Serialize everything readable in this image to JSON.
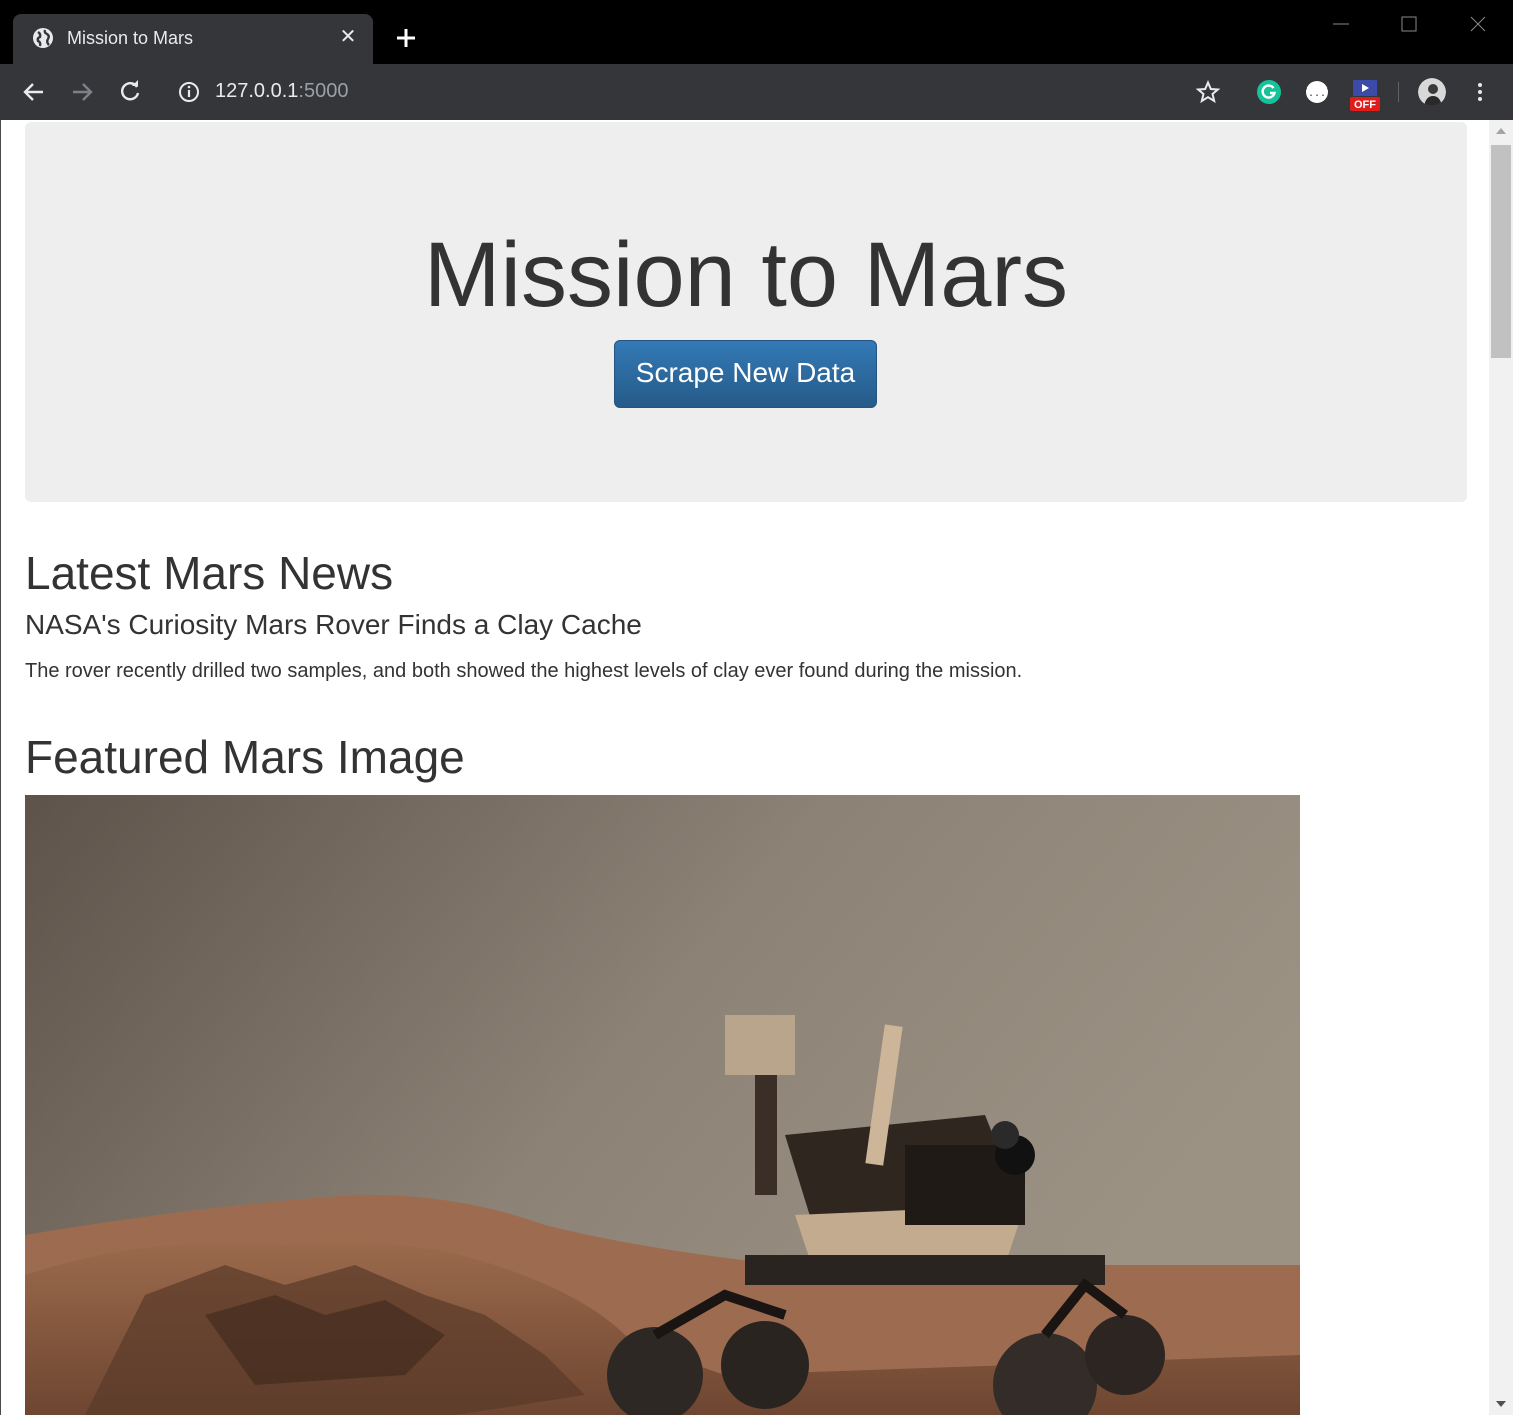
{
  "browser": {
    "tab_title": "Mission to Mars",
    "url_host": "127.0.0.1",
    "url_port": ":5000",
    "extension_badge": "OFF"
  },
  "page": {
    "jumbotron_title": "Mission to Mars",
    "scrape_button": "Scrape New Data",
    "news_heading": "Latest Mars News",
    "news_title": "NASA's Curiosity Mars Rover Finds a Clay Cache",
    "news_paragraph": "The rover recently drilled two samples, and both showed the highest levels of clay ever found during the mission.",
    "image_heading": "Featured Mars Image"
  },
  "colors": {
    "chrome_dark": "#35363a",
    "jumbotron_bg": "#eeeeee",
    "button_blue": "#337ab7",
    "grammarly_green": "#15c39a"
  }
}
